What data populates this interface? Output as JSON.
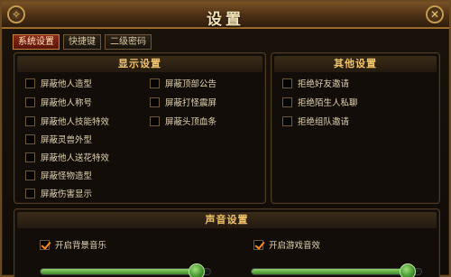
{
  "window": {
    "title": "设置"
  },
  "tabs": [
    {
      "label": "系统设置",
      "active": true
    },
    {
      "label": "快捷键",
      "active": false
    },
    {
      "label": "二级密码",
      "active": false
    }
  ],
  "display": {
    "header": "显示设置",
    "options": [
      {
        "label": "屏蔽他人造型",
        "checked": false
      },
      {
        "label": "屏蔽他人称号",
        "checked": false
      },
      {
        "label": "屏蔽他人技能特效",
        "checked": false
      },
      {
        "label": "屏蔽灵兽外型",
        "checked": false
      },
      {
        "label": "屏蔽他人送花特效",
        "checked": false
      },
      {
        "label": "屏蔽怪物造型",
        "checked": false
      },
      {
        "label": "屏蔽伤害显示",
        "checked": false
      },
      {
        "label": "屏蔽顶部公告",
        "checked": false
      },
      {
        "label": "屏蔽打怪震屏",
        "checked": false
      },
      {
        "label": "屏蔽头顶血条",
        "checked": false
      }
    ]
  },
  "other": {
    "header": "其他设置",
    "options": [
      {
        "label": "拒绝好友邀请",
        "checked": false
      },
      {
        "label": "拒绝陌生人私聊",
        "checked": false
      },
      {
        "label": "拒绝组队邀请",
        "checked": false
      }
    ]
  },
  "sound": {
    "header": "声音设置",
    "music": {
      "label": "开启背景音乐",
      "checked": true,
      "volume": 1.0
    },
    "effects": {
      "label": "开启游戏音效",
      "checked": true,
      "volume": 1.0
    }
  },
  "colors": {
    "accent": "#f1c36a",
    "active_tab": "#8b2a1a",
    "check": "#ff8a1a",
    "slider": "#5fb03f"
  }
}
